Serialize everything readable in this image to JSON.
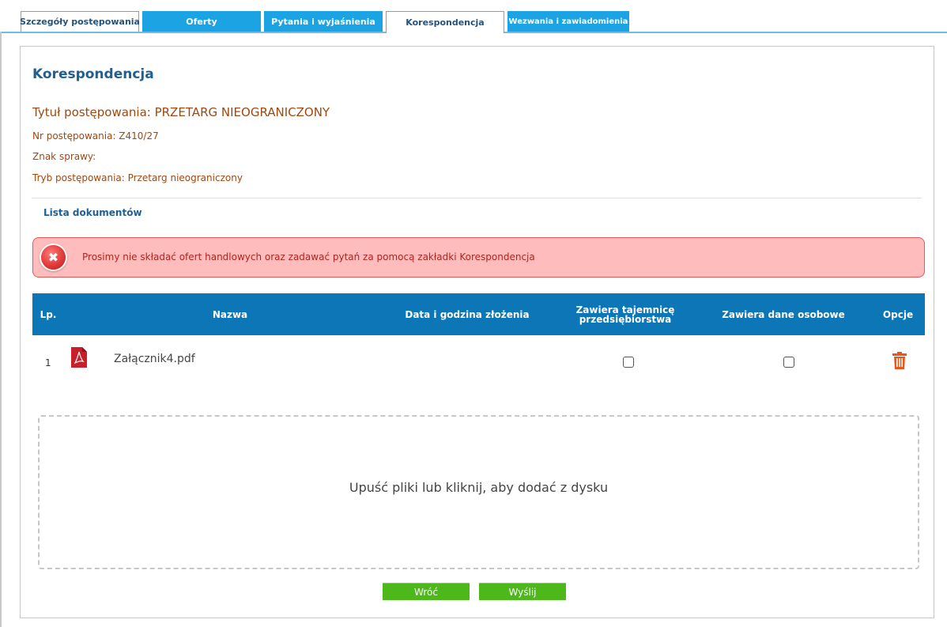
{
  "tabs": [
    {
      "label": "Szczegóły postępowania"
    },
    {
      "label": "Oferty"
    },
    {
      "label": "Pytania i wyjaśnienia"
    },
    {
      "label": "Korespondencja"
    },
    {
      "label": "Wezwania i zawiadomienia"
    }
  ],
  "page": {
    "title": "Korespondencja"
  },
  "info": {
    "title": "Tytuł postępowania: PRZETARG NIEOGRANICZONY",
    "number": "Nr postępowania: Z410/27",
    "case_sign": "Znak sprawy:",
    "mode": "Tryb postępowania: Przetarg nieograniczony"
  },
  "documents": {
    "section_title": "Lista dokumentów"
  },
  "alert": {
    "icon": "x-icon",
    "text": "Prosimy nie składać ofert handlowych oraz zadawać pytań za pomocą zakładki Korespondencja"
  },
  "table": {
    "headers": {
      "lp": "Lp.",
      "name": "Nazwa",
      "date": "Data i godzina złożenia",
      "secret": "Zawiera tajemnicę przedsiębiorstwa",
      "personal": "Zawiera dane osobowe",
      "options": "Opcje"
    },
    "rows": [
      {
        "lp": "1",
        "name": "Załącznik4.pdf",
        "date": "",
        "secret": false,
        "personal": false,
        "file_icon": "pdf-icon",
        "option_icon": "trash-icon"
      }
    ]
  },
  "dropzone": {
    "text": "Upuść pliki lub kliknij, aby dodać z dysku"
  },
  "buttons": {
    "back": "Wróć",
    "send": "Wyślij"
  },
  "colors": {
    "tab_blue": "#1ba3e3",
    "header_blue": "#0c76b6",
    "title_blue": "#1f5f94",
    "info_brown": "#a0480e",
    "alert_bg": "#ffbcbc",
    "alert_border": "#e05a5a",
    "button_green": "#4cb81a",
    "trash_orange": "#e8561a",
    "pdf_red": "#c8202a"
  }
}
